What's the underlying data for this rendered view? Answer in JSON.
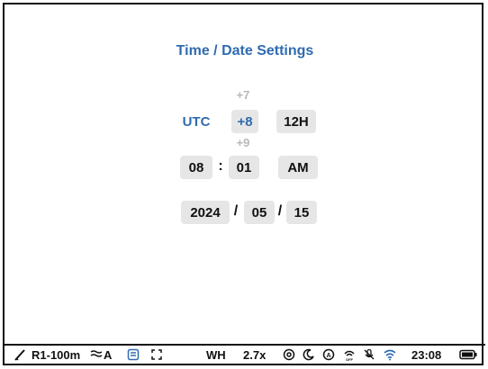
{
  "header": {
    "title": "Time / Date Settings"
  },
  "timezone": {
    "label": "UTC",
    "prev": "+7",
    "selected": "+8",
    "next": "+9",
    "format": "12H"
  },
  "time": {
    "hour": "08",
    "separator": ":",
    "minute": "01",
    "ampm": "AM"
  },
  "date": {
    "year": "2024",
    "sep1": "/",
    "month": "05",
    "sep2": "/",
    "day": "15"
  },
  "status_bar": {
    "profile": "R1-100m",
    "mode_suffix": "A",
    "wh": "WH",
    "zoom": "2.7x",
    "clock": "23:08"
  },
  "colors": {
    "accent": "#2f6bb0",
    "chip_bg": "#e6e6e6"
  }
}
